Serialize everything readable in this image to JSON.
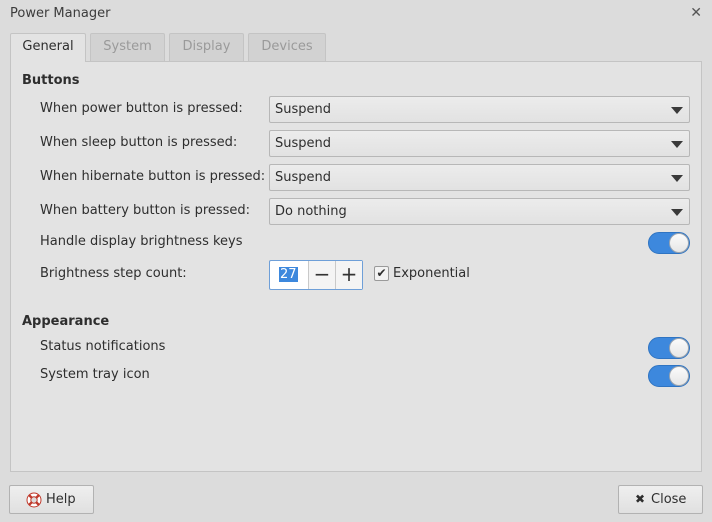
{
  "window": {
    "title": "Power Manager"
  },
  "tabs": [
    {
      "label": "General",
      "active": true
    },
    {
      "label": "System",
      "active": false
    },
    {
      "label": "Display",
      "active": false
    },
    {
      "label": "Devices",
      "active": false
    }
  ],
  "buttons_section": {
    "title": "Buttons",
    "power": {
      "label": "When power button is pressed:",
      "value": "Suspend"
    },
    "sleep": {
      "label": "When sleep button is pressed:",
      "value": "Suspend"
    },
    "hibernate": {
      "label": "When hibernate button is pressed:",
      "value": "Suspend"
    },
    "battery": {
      "label": "When battery button is pressed:",
      "value": "Do nothing"
    },
    "brightness_keys": {
      "label": "Handle display brightness keys",
      "enabled": true
    },
    "brightness_step": {
      "label": "Brightness step count:",
      "value": "27"
    },
    "exponential": {
      "label": "Exponential",
      "checked": true
    }
  },
  "appearance_section": {
    "title": "Appearance",
    "status_notifications": {
      "label": "Status notifications",
      "enabled": true
    },
    "system_tray_icon": {
      "label": "System tray icon",
      "enabled": true
    }
  },
  "footer": {
    "help_label": "Help",
    "close_label": "Close"
  },
  "colors": {
    "accent": "#3d88dd",
    "background": "#dcdcdc",
    "panel": "#e3e3e3"
  }
}
